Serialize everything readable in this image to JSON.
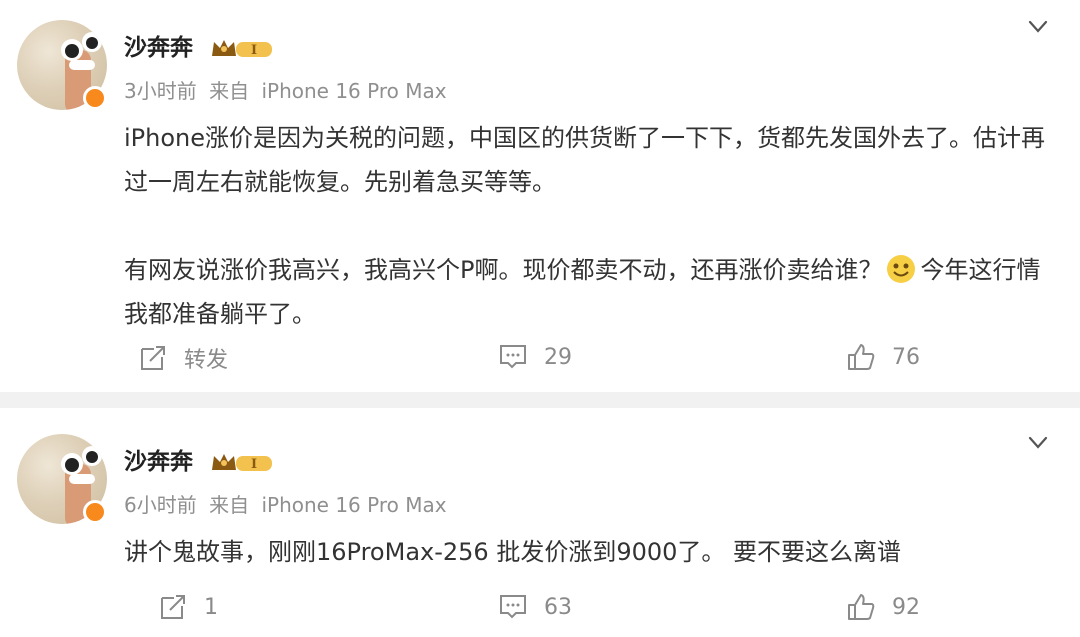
{
  "posts": [
    {
      "author": "沙奔奔",
      "time": "3小时前",
      "source_prefix": "来自",
      "source": "iPhone 16 Pro Max",
      "paragraph1": "iPhone涨价是因为关税的问题，中国区的供货断了一下下，货都先发国外去了。估计再过一周左右就能恢复。先别着急买等等。",
      "paragraph2_before": "有网友说涨价我高兴，我高兴个P啊。现价都卖不动，还再涨价卖给谁？",
      "emoji": "smile-emoji",
      "paragraph2_after": "今年这行情我都准备躺平了。",
      "actions": {
        "repost": "转发",
        "comments": "29",
        "likes": "76"
      }
    },
    {
      "author": "沙奔奔",
      "time": "6小时前",
      "source_prefix": "来自",
      "source": "iPhone 16 Pro Max",
      "text": "讲个鬼故事，刚刚16ProMax-256 批发价涨到9000了。 要不要这么离谱",
      "actions": {
        "repost": "1",
        "comments": "63",
        "likes": "92"
      }
    }
  ],
  "vip_badge_text": "I",
  "colors": {
    "verified": "#f7891d",
    "vip_gold": "#e6b04a",
    "separator": "#f1f1f1"
  }
}
